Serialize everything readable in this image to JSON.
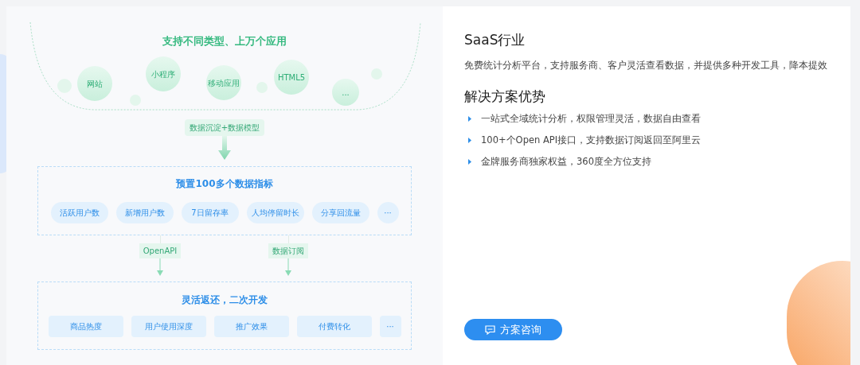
{
  "apps": {
    "title": "支持不同类型、上万个应用",
    "bubbles": [
      {
        "label": "网站"
      },
      {
        "label": "小程序"
      },
      {
        "label": "移动应用"
      },
      {
        "label": "HTML5"
      },
      {
        "label": "..."
      }
    ]
  },
  "flow_tag": "数据沉淀+数据模型",
  "metrics": {
    "title": "预置100多个数据指标",
    "items": [
      "活跃用户数",
      "新增用户数",
      "7日留存率",
      "人均停留时长",
      "分享回流量",
      "···"
    ]
  },
  "connectors": [
    "OpenAPI",
    "数据订阅"
  ],
  "development": {
    "title": "灵活返还，二次开发",
    "items": [
      "商品热度",
      "用户使用深度",
      "推广效果",
      "付费转化",
      "···"
    ]
  },
  "industry": {
    "title": "SaaS行业",
    "description": "免费统计分析平台，支持服务商、客户灵活查看数据，并提供多种开发工具，降本提效"
  },
  "advantages": {
    "title": "解决方案优势",
    "items": [
      "一站式全域统计分析，权限管理灵活，数据自由查看",
      "100+个Open API接口，支持数据订阅返回至阿里云",
      "金牌服务商独家权益，360度全方位支持"
    ]
  },
  "button": "方案咨询"
}
